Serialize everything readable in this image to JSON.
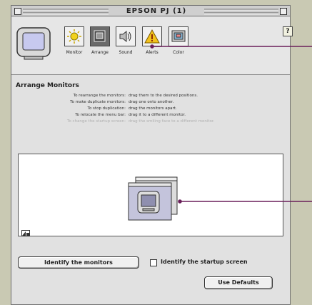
{
  "window": {
    "title": "EPSON PJ  (1)"
  },
  "toolbar": {
    "tools": [
      {
        "label": "Monitor"
      },
      {
        "label": "Arrange"
      },
      {
        "label": "Sound"
      },
      {
        "label": "Alerts"
      },
      {
        "label": "Color"
      }
    ],
    "help_label": "?"
  },
  "section": {
    "title": "Arrange Monitors"
  },
  "instructions": [
    {
      "key": "To rearrange the monitors:",
      "value": "drag them to the desired positions."
    },
    {
      "key": "To make duplicate monitors:",
      "value": "drag one onto another."
    },
    {
      "key": "To stop duplication:",
      "value": "drag the monitors apart."
    },
    {
      "key": "To relocate the menu bar:",
      "value": "drag it to a different monitor."
    },
    {
      "key": "To change the startup screen:",
      "value": "drag the smiling face to a different monitor."
    }
  ],
  "buttons": {
    "identify": "Identify the monitors",
    "startup_check": "Identify the startup screen",
    "defaults": "Use Defaults"
  },
  "colors": {
    "callout": "#6a1f5a",
    "background": "#c9c9b3"
  }
}
